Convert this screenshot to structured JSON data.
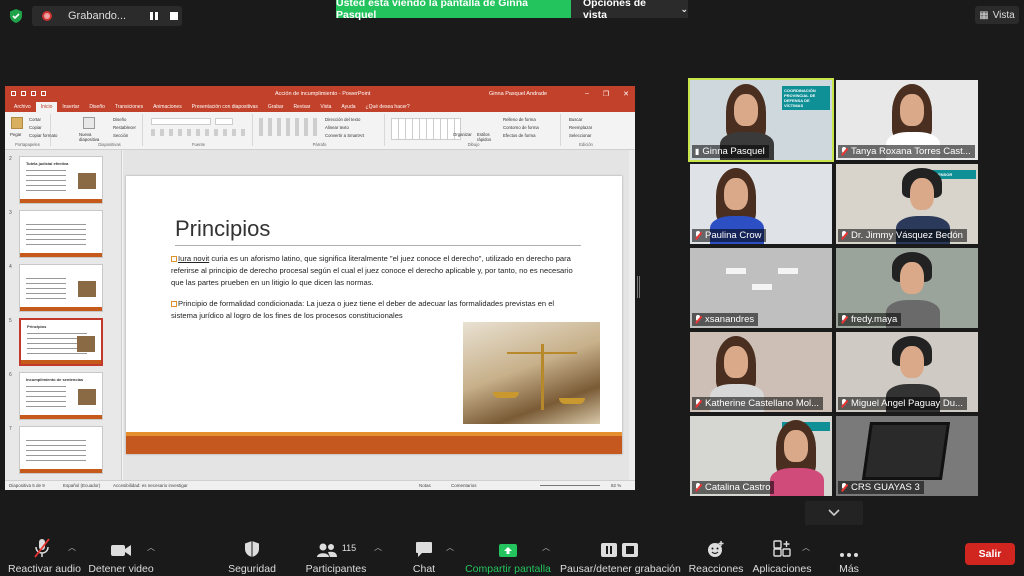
{
  "topbar": {
    "recording_label": "Grabando...",
    "share_banner": "Usted está viendo la pantalla de Ginna Pasquel",
    "view_options": "Opciones de vista",
    "view_button": "Vista"
  },
  "ppt": {
    "title": "Acción de incumplimiento  -  PowerPoint",
    "user": "Ginna Pasquel Andrade",
    "tabs": [
      "Archivo",
      "Inicio",
      "Insertar",
      "Diseño",
      "Transiciones",
      "Animaciones",
      "Presentación con diapositivas",
      "Grabar",
      "Revisar",
      "Vista",
      "Ayuda",
      "¿Qué desea hacer?"
    ],
    "ribbon": {
      "paste": "Pegar",
      "cut": "Cortar",
      "copy": "Copiar",
      "format_painter": "Copiar formato",
      "new_slide": "Nueva diapositiva",
      "layout": "Diseño",
      "reset": "Restablecer",
      "section": "Sección",
      "text_direction": "Dirección del texto",
      "align_text": "Alinear texto",
      "smartart": "Convertir a SmartArt",
      "arrange": "Organizar",
      "quick_styles": "Estilos rápidos",
      "shape_fill": "Relleno de forma",
      "shape_outline": "Contorno de forma",
      "shape_effects": "Efectos de forma",
      "find": "Buscar",
      "replace": "Reemplazar",
      "select": "Seleccionar",
      "groups": [
        "Portapapeles",
        "Diapositivas",
        "Fuente",
        "Párrafo",
        "Dibujo",
        "Edición"
      ]
    },
    "thumb_numbers": [
      "2",
      "3",
      "4",
      "5",
      "6",
      "7"
    ],
    "thumb_titles": [
      "Tutela judicial efectiva",
      "",
      "",
      "Principios",
      "Incumplimiento de sentencias",
      ""
    ],
    "slide": {
      "title": "Principios",
      "p1_link": "Iura novit",
      "p1_rest": " curia es un aforismo latino, que significa literalmente \"el juez conoce el derecho\", utilizado en derecho para referirse al principio de derecho procesal según el cual el juez conoce el derecho aplicable y, por tanto, no es necesario que las partes prueben en un litigio lo que dicen las normas.",
      "p2": "Principio de formalidad condicionada: La jueza o juez tiene el deber de adecuar las formalidades previstas en el sistema jurídico al logro de los fines de los procesos constitucionales"
    },
    "status": {
      "slide_count": "Diapositiva 5 de 9",
      "language": "Español (Ecuador)",
      "accessibility": "Accesibilidad: es necesario investigar",
      "notes": "Notas",
      "comments": "Comentarios",
      "zoom": "82 %"
    }
  },
  "participants_grid": [
    {
      "name": "Ginna Pasquel",
      "active": true,
      "muted": false,
      "sign": "COORDINACIÓN PROVINCIAL DE DEFENSA DE VÍCTIMAS"
    },
    {
      "name": "Tanya Roxana Torres Cast...",
      "active": false,
      "muted": true
    },
    {
      "name": "Paulina Crow",
      "active": false,
      "muted": true
    },
    {
      "name": "Dr. Jimmy Vásquez Bedón",
      "active": false,
      "muted": true,
      "sign": "DEFENSOR"
    },
    {
      "name": "xsanandres",
      "active": false,
      "muted": true
    },
    {
      "name": "fredy.maya",
      "active": false,
      "muted": true
    },
    {
      "name": "Katherine Castellano Mol...",
      "active": false,
      "muted": true
    },
    {
      "name": "Miguel Angel Paguay Du...",
      "active": false,
      "muted": true
    },
    {
      "name": "Catalina Castro",
      "active": false,
      "muted": true,
      "sign": "DEFENSORA"
    },
    {
      "name": "CRS GUAYAS 3",
      "active": false,
      "muted": true
    }
  ],
  "toolbar": {
    "audio": "Reactivar audio",
    "video": "Detener video",
    "security": "Seguridad",
    "participants": "Participantes",
    "participant_count": "115",
    "chat": "Chat",
    "share": "Compartir pantalla",
    "record": "Pausar/detener grabación",
    "reactions": "Reacciones",
    "apps": "Aplicaciones",
    "more": "Más",
    "leave": "Salir"
  },
  "colors": {
    "share_green": "#23c45e",
    "leave_red": "#d0261f",
    "ppt_orange": "#c2412a",
    "active_speaker": "#c8e64a"
  }
}
